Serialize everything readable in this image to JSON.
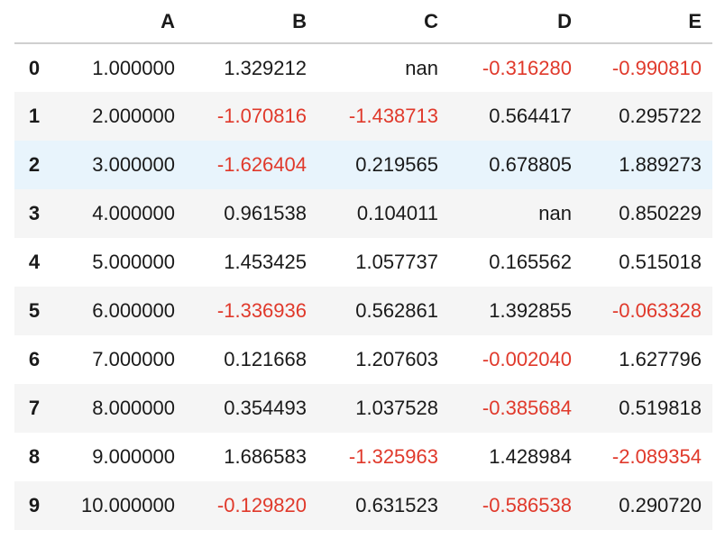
{
  "table": {
    "columns": [
      "A",
      "B",
      "C",
      "D",
      "E"
    ],
    "rows": [
      {
        "index": "0",
        "cells": [
          "1.000000",
          "1.329212",
          "nan",
          "-0.316280",
          "-0.990810"
        ]
      },
      {
        "index": "1",
        "cells": [
          "2.000000",
          "-1.070816",
          "-1.438713",
          "0.564417",
          "0.295722"
        ]
      },
      {
        "index": "2",
        "cells": [
          "3.000000",
          "-1.626404",
          "0.219565",
          "0.678805",
          "1.889273"
        ]
      },
      {
        "index": "3",
        "cells": [
          "4.000000",
          "0.961538",
          "0.104011",
          "nan",
          "0.850229"
        ]
      },
      {
        "index": "4",
        "cells": [
          "5.000000",
          "1.453425",
          "1.057737",
          "0.165562",
          "0.515018"
        ]
      },
      {
        "index": "5",
        "cells": [
          "6.000000",
          "-1.336936",
          "0.562861",
          "1.392855",
          "-0.063328"
        ]
      },
      {
        "index": "6",
        "cells": [
          "7.000000",
          "0.121668",
          "1.207603",
          "-0.002040",
          "1.627796"
        ]
      },
      {
        "index": "7",
        "cells": [
          "8.000000",
          "0.354493",
          "1.037528",
          "-0.385684",
          "0.519818"
        ]
      },
      {
        "index": "8",
        "cells": [
          "9.000000",
          "1.686583",
          "-1.325963",
          "1.428984",
          "-2.089354"
        ]
      },
      {
        "index": "9",
        "cells": [
          "10.000000",
          "-0.129820",
          "0.631523",
          "-0.586538",
          "0.290720"
        ]
      }
    ],
    "highlighted_row": 2,
    "colors": {
      "negative": "#e0392b",
      "highlight_bg": "#e8f4fc",
      "stripe_bg": "#f5f5f5",
      "header_rule": "#cfcfcf"
    }
  }
}
